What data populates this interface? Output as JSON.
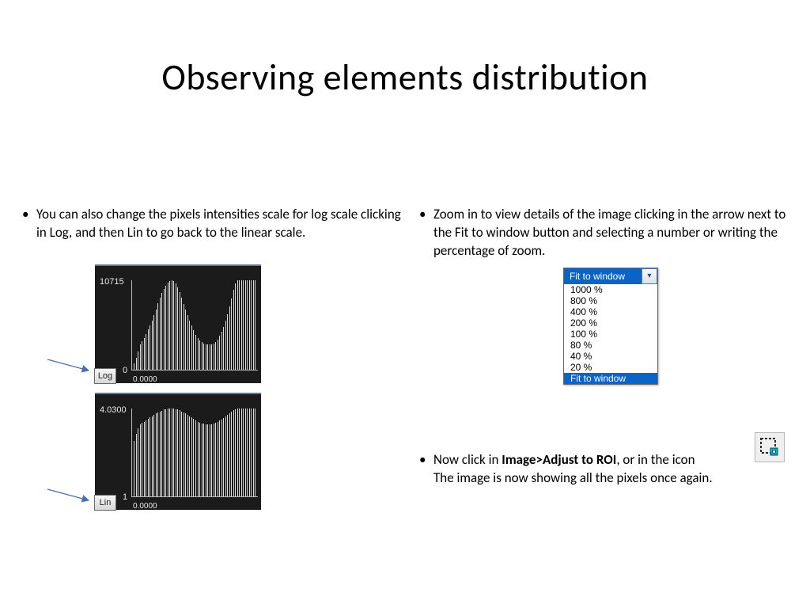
{
  "title": "Observing elements distribution",
  "left_bullet": "You can also change the pixels intensities scale for log scale clicking in Log, and then Lin to go back to the linear scale.",
  "right_bullet": "Zoom in to view details of the image clicking in the arrow next to the Fit to window button and selecting a number or writing the percentage of zoom.",
  "bottom_bullet_prefix": "Now click in ",
  "bottom_bullet_bold": "Image>Adjust to ROI",
  "bottom_bullet_mid": ", or in the icon",
  "bottom_bullet_line2": "The image is now showing all the pixels once again.",
  "hist1": {
    "ymax": "10715",
    "ymin": "0",
    "xmin": "0.0000",
    "btn": "Log"
  },
  "hist2": {
    "ymax": "4.0300",
    "ymin": "1",
    "xmin": "0.0000",
    "btn": "Lin"
  },
  "zoom": {
    "selected": "Fit to window",
    "options": [
      "1000 %",
      "800 %",
      "400 %",
      "200 %",
      "100 %",
      "80 %",
      "40 %",
      "20 %"
    ],
    "highlighted": "Fit to window"
  },
  "chart_data": [
    {
      "type": "bar",
      "title": "Pixel intensity histogram (linear y)",
      "xlabel": "",
      "ylabel": "",
      "ylim": [
        0,
        10715
      ],
      "x_start": 0.0,
      "values": [
        800,
        1400,
        2200,
        3000,
        3400,
        3800,
        4300,
        4800,
        5300,
        5900,
        6500,
        7200,
        8000,
        8600,
        9200,
        9700,
        10100,
        10400,
        10600,
        10715,
        10600,
        10300,
        9900,
        9300,
        8600,
        7900,
        7200,
        6500,
        5900,
        5300,
        4700,
        4200,
        3800,
        3500,
        3300,
        3150,
        3050,
        3000,
        3000,
        3050,
        3150,
        3350,
        3650,
        4050,
        4550,
        5150,
        5850,
        6650,
        7550,
        8550,
        9550,
        10300,
        10715,
        10715,
        10715,
        10715,
        10715,
        10715,
        10715,
        10715,
        10715,
        10715
      ]
    },
    {
      "type": "bar",
      "title": "Pixel intensity histogram (log y)",
      "xlabel": "",
      "ylabel": "",
      "ylim": [
        1,
        4.03
      ],
      "x_start": 0.0,
      "values": [
        2.9,
        3.15,
        3.34,
        3.48,
        3.53,
        3.58,
        3.63,
        3.68,
        3.72,
        3.77,
        3.81,
        3.86,
        3.9,
        3.93,
        3.96,
        3.99,
        4.0,
        4.02,
        4.03,
        4.03,
        4.03,
        4.01,
        4.0,
        3.97,
        3.93,
        3.9,
        3.86,
        3.81,
        3.77,
        3.72,
        3.67,
        3.62,
        3.58,
        3.54,
        3.52,
        3.5,
        3.48,
        3.48,
        3.48,
        3.48,
        3.5,
        3.53,
        3.56,
        3.61,
        3.66,
        3.71,
        3.77,
        3.82,
        3.88,
        3.93,
        3.98,
        4.01,
        4.03,
        4.03,
        4.03,
        4.03,
        4.03,
        4.03,
        4.03,
        4.03,
        4.03,
        4.03
      ]
    }
  ]
}
